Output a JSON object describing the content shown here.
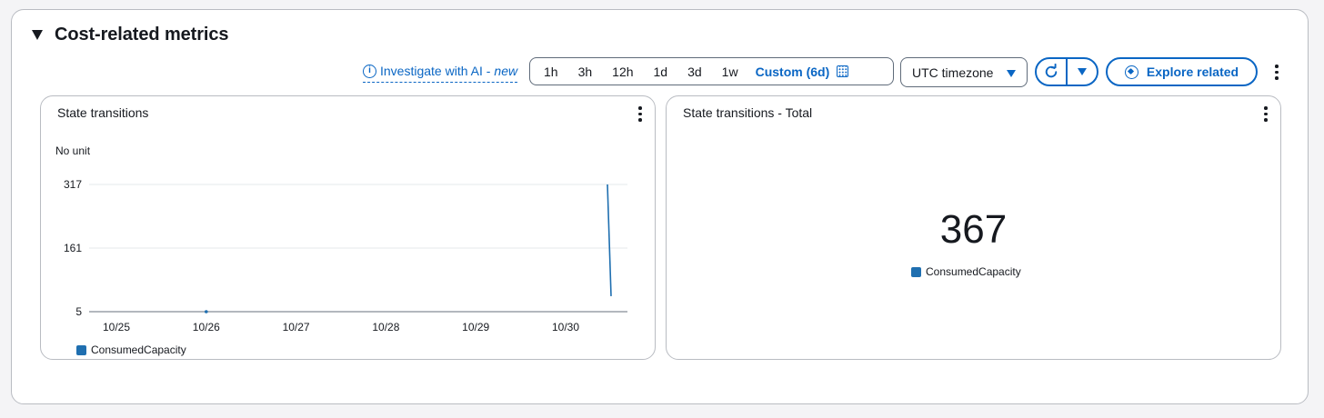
{
  "section": {
    "title": "Cost-related metrics"
  },
  "toolbar": {
    "ai_link": "Investigate with AI - ",
    "ai_new": "new",
    "ranges": [
      "1h",
      "3h",
      "12h",
      "1d",
      "3d",
      "1w"
    ],
    "custom": "Custom (6d)",
    "timezone": "UTC timezone",
    "explore": "Explore related"
  },
  "widgets": {
    "line": {
      "title": "State transitions",
      "unit": "No unit",
      "legend": "ConsumedCapacity"
    },
    "total": {
      "title": "State transitions - Total",
      "value": "367",
      "legend": "ConsumedCapacity"
    }
  },
  "chart_data": {
    "type": "line",
    "title": "State transitions",
    "ylabel": "No unit",
    "xlabel": "",
    "ylim": [
      5,
      317
    ],
    "y_ticks": [
      317,
      161,
      5
    ],
    "categories": [
      "10/25",
      "10/26",
      "10/27",
      "10/28",
      "10/29",
      "10/30"
    ],
    "series": [
      {
        "name": "ConsumedCapacity",
        "color": "#1f6fb0",
        "points": [
          {
            "x": "10/26",
            "y": 5
          },
          {
            "x": "10/30 ~13:00",
            "y": 317
          },
          {
            "x": "10/30 ~13:30",
            "y": 43
          }
        ]
      }
    ],
    "grid": true,
    "legend": "bottom-left"
  },
  "colors": {
    "accent": "#0a66c4",
    "series": "#1f6fb0",
    "border": "#b9bcc2"
  }
}
